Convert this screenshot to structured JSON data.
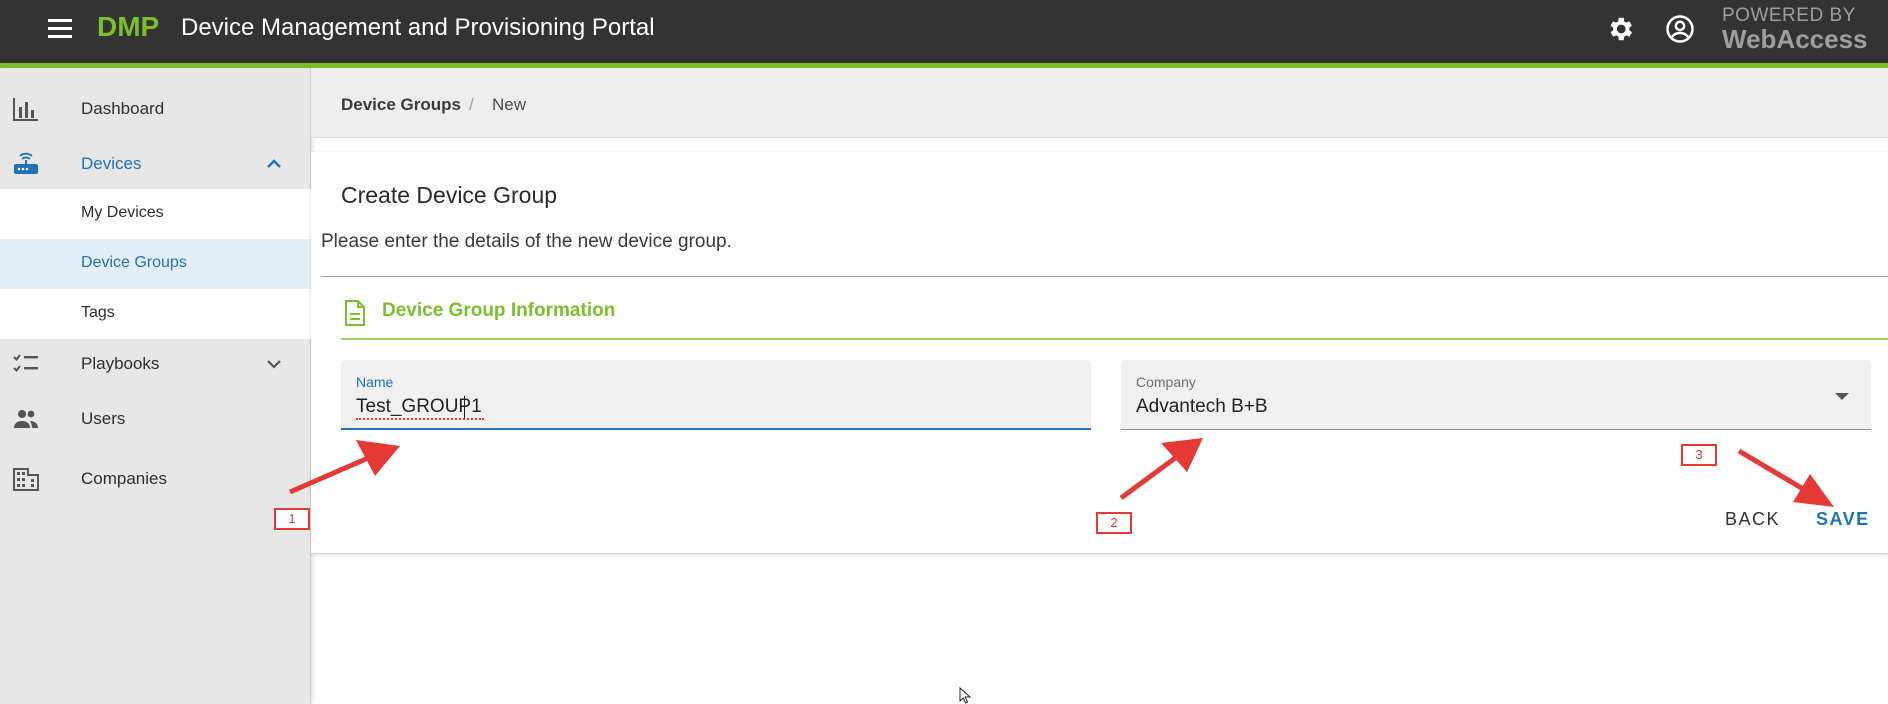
{
  "header": {
    "brand": "DMP",
    "title": "Device Management and Provisioning Portal",
    "powered_by_line1": "POWERED BY",
    "powered_by_line2": "WebAccess"
  },
  "sidebar": {
    "items": [
      {
        "label": "Dashboard",
        "icon": "bar-chart-icon"
      },
      {
        "label": "Devices",
        "icon": "router-icon",
        "expanded": true
      },
      {
        "label": "My Devices"
      },
      {
        "label": "Device Groups",
        "active": true
      },
      {
        "label": "Tags"
      },
      {
        "label": "Playbooks",
        "icon": "checklist-icon",
        "expanded": false
      },
      {
        "label": "Users",
        "icon": "users-icon"
      },
      {
        "label": "Companies",
        "icon": "building-icon"
      }
    ]
  },
  "breadcrumb": {
    "root": "Device Groups",
    "separator": "/",
    "current": "New"
  },
  "form": {
    "title": "Create Device Group",
    "description": "Please enter the details of the new device group.",
    "section_title": "Device Group Information",
    "name_label": "Name",
    "name_value": "Test_GROUP1",
    "company_label": "Company",
    "company_value": "Advantech B+B",
    "back_label": "BACK",
    "save_label": "SAVE"
  },
  "annotations": {
    "step1": "1",
    "step2": "2",
    "step3": "3"
  },
  "colors": {
    "brand_green": "#7bbf2a",
    "primary_blue": "#1e73b8",
    "header_bg": "#333333",
    "annotation_red": "#e53935"
  }
}
